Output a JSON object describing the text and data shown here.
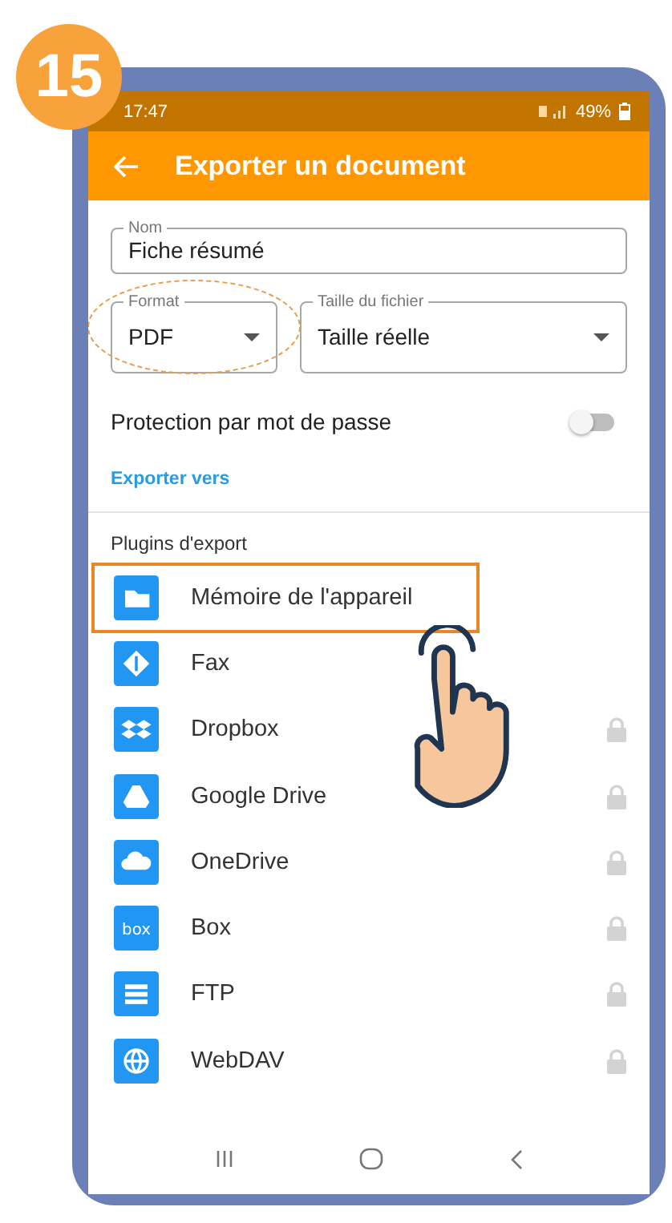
{
  "step": "15",
  "status_bar": {
    "time": "17:47",
    "battery": "49%"
  },
  "app_bar": {
    "title": "Exporter un document"
  },
  "name_field": {
    "label": "Nom",
    "value": "Fiche résumé"
  },
  "format_field": {
    "label": "Format",
    "value": "PDF",
    "circled": true
  },
  "size_field": {
    "label": "Taille du fichier",
    "value": "Taille réelle"
  },
  "password": {
    "label": "Protection par mot de passe",
    "on": false
  },
  "export_to": "Exporter vers",
  "plugins_heading": "Plugins d'export",
  "plugins": [
    {
      "label": "Mémoire de l'appareil",
      "locked": false,
      "highlighted": true
    },
    {
      "label": "Fax",
      "locked": false,
      "highlighted": false
    },
    {
      "label": "Dropbox",
      "locked": true,
      "highlighted": false
    },
    {
      "label": "Google Drive",
      "locked": true,
      "highlighted": false
    },
    {
      "label": "OneDrive",
      "locked": true,
      "highlighted": false
    },
    {
      "label": "Box",
      "icon_text": "box",
      "locked": true,
      "highlighted": false
    },
    {
      "label": "FTP",
      "locked": true,
      "highlighted": false
    },
    {
      "label": "WebDAV",
      "locked": true,
      "highlighted": false
    }
  ]
}
